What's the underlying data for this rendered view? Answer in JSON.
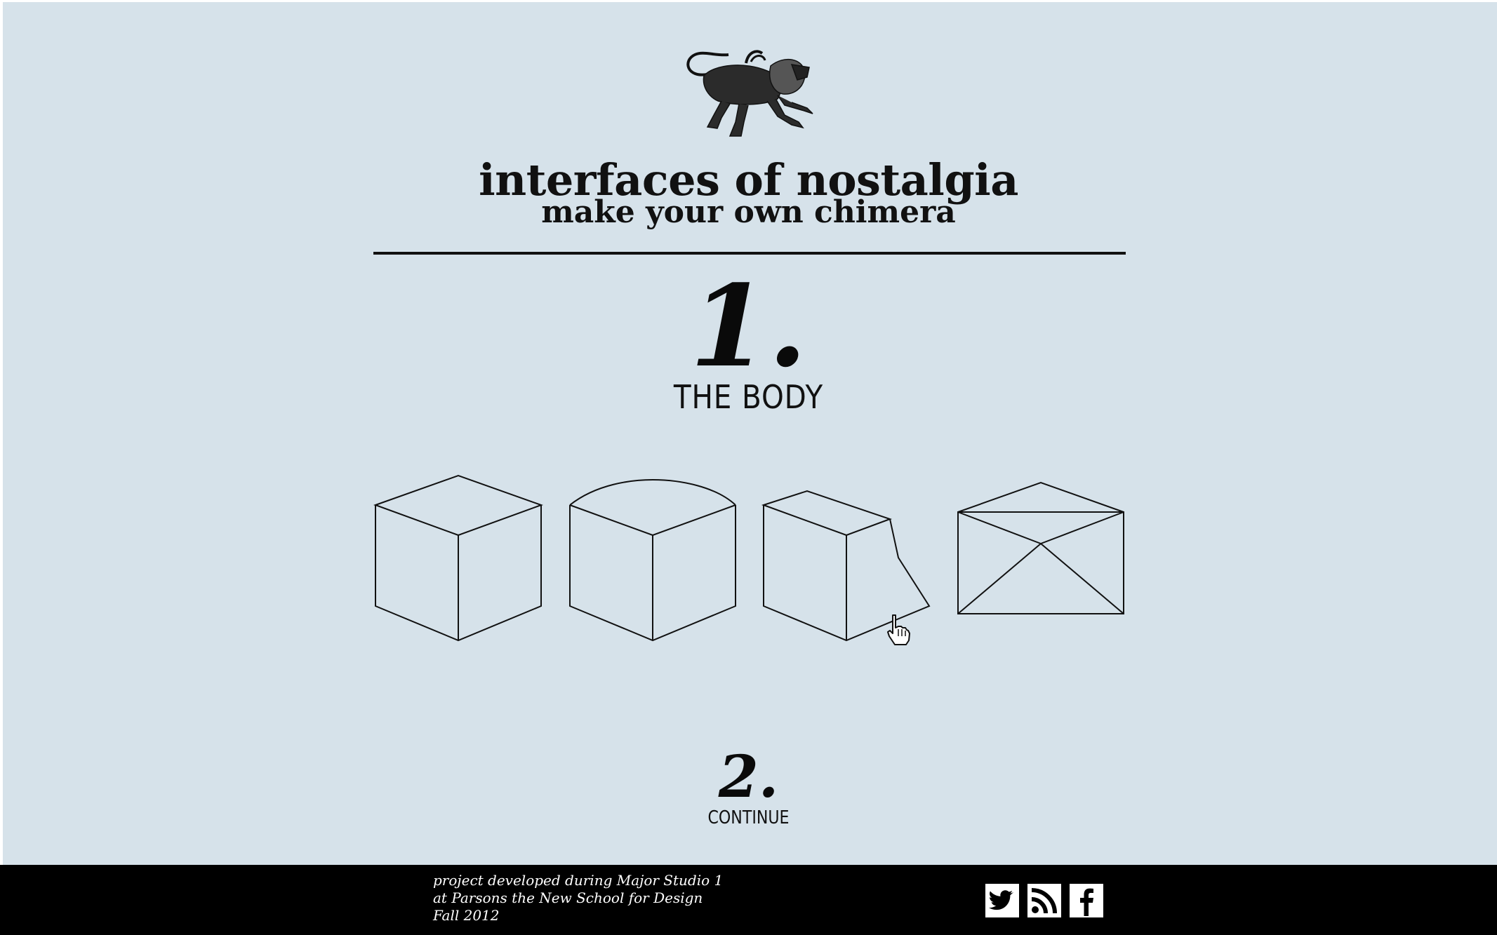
{
  "header": {
    "title": "interfaces of nostalgia",
    "subtitle": "make your own chimera",
    "logo_icon": "chimera-logo-icon"
  },
  "step1": {
    "number": "1.",
    "label": "THE BODY",
    "options": [
      {
        "icon": "cube-body-shape-icon"
      },
      {
        "icon": "rounded-top-body-shape-icon"
      },
      {
        "icon": "cut-corner-body-shape-icon"
      },
      {
        "icon": "envelope-body-shape-icon"
      }
    ]
  },
  "step2": {
    "number": "2.",
    "label": "CONTINUE"
  },
  "footer": {
    "credits": [
      "project developed during Major Studio 1",
      "at Parsons the New School for Design",
      "Fall 2012"
    ],
    "social": [
      {
        "icon": "twitter-icon"
      },
      {
        "icon": "rss-icon"
      },
      {
        "icon": "facebook-icon"
      }
    ]
  },
  "colors": {
    "background": "#d6e2ea",
    "ink": "#111111",
    "footer": "#000000"
  }
}
